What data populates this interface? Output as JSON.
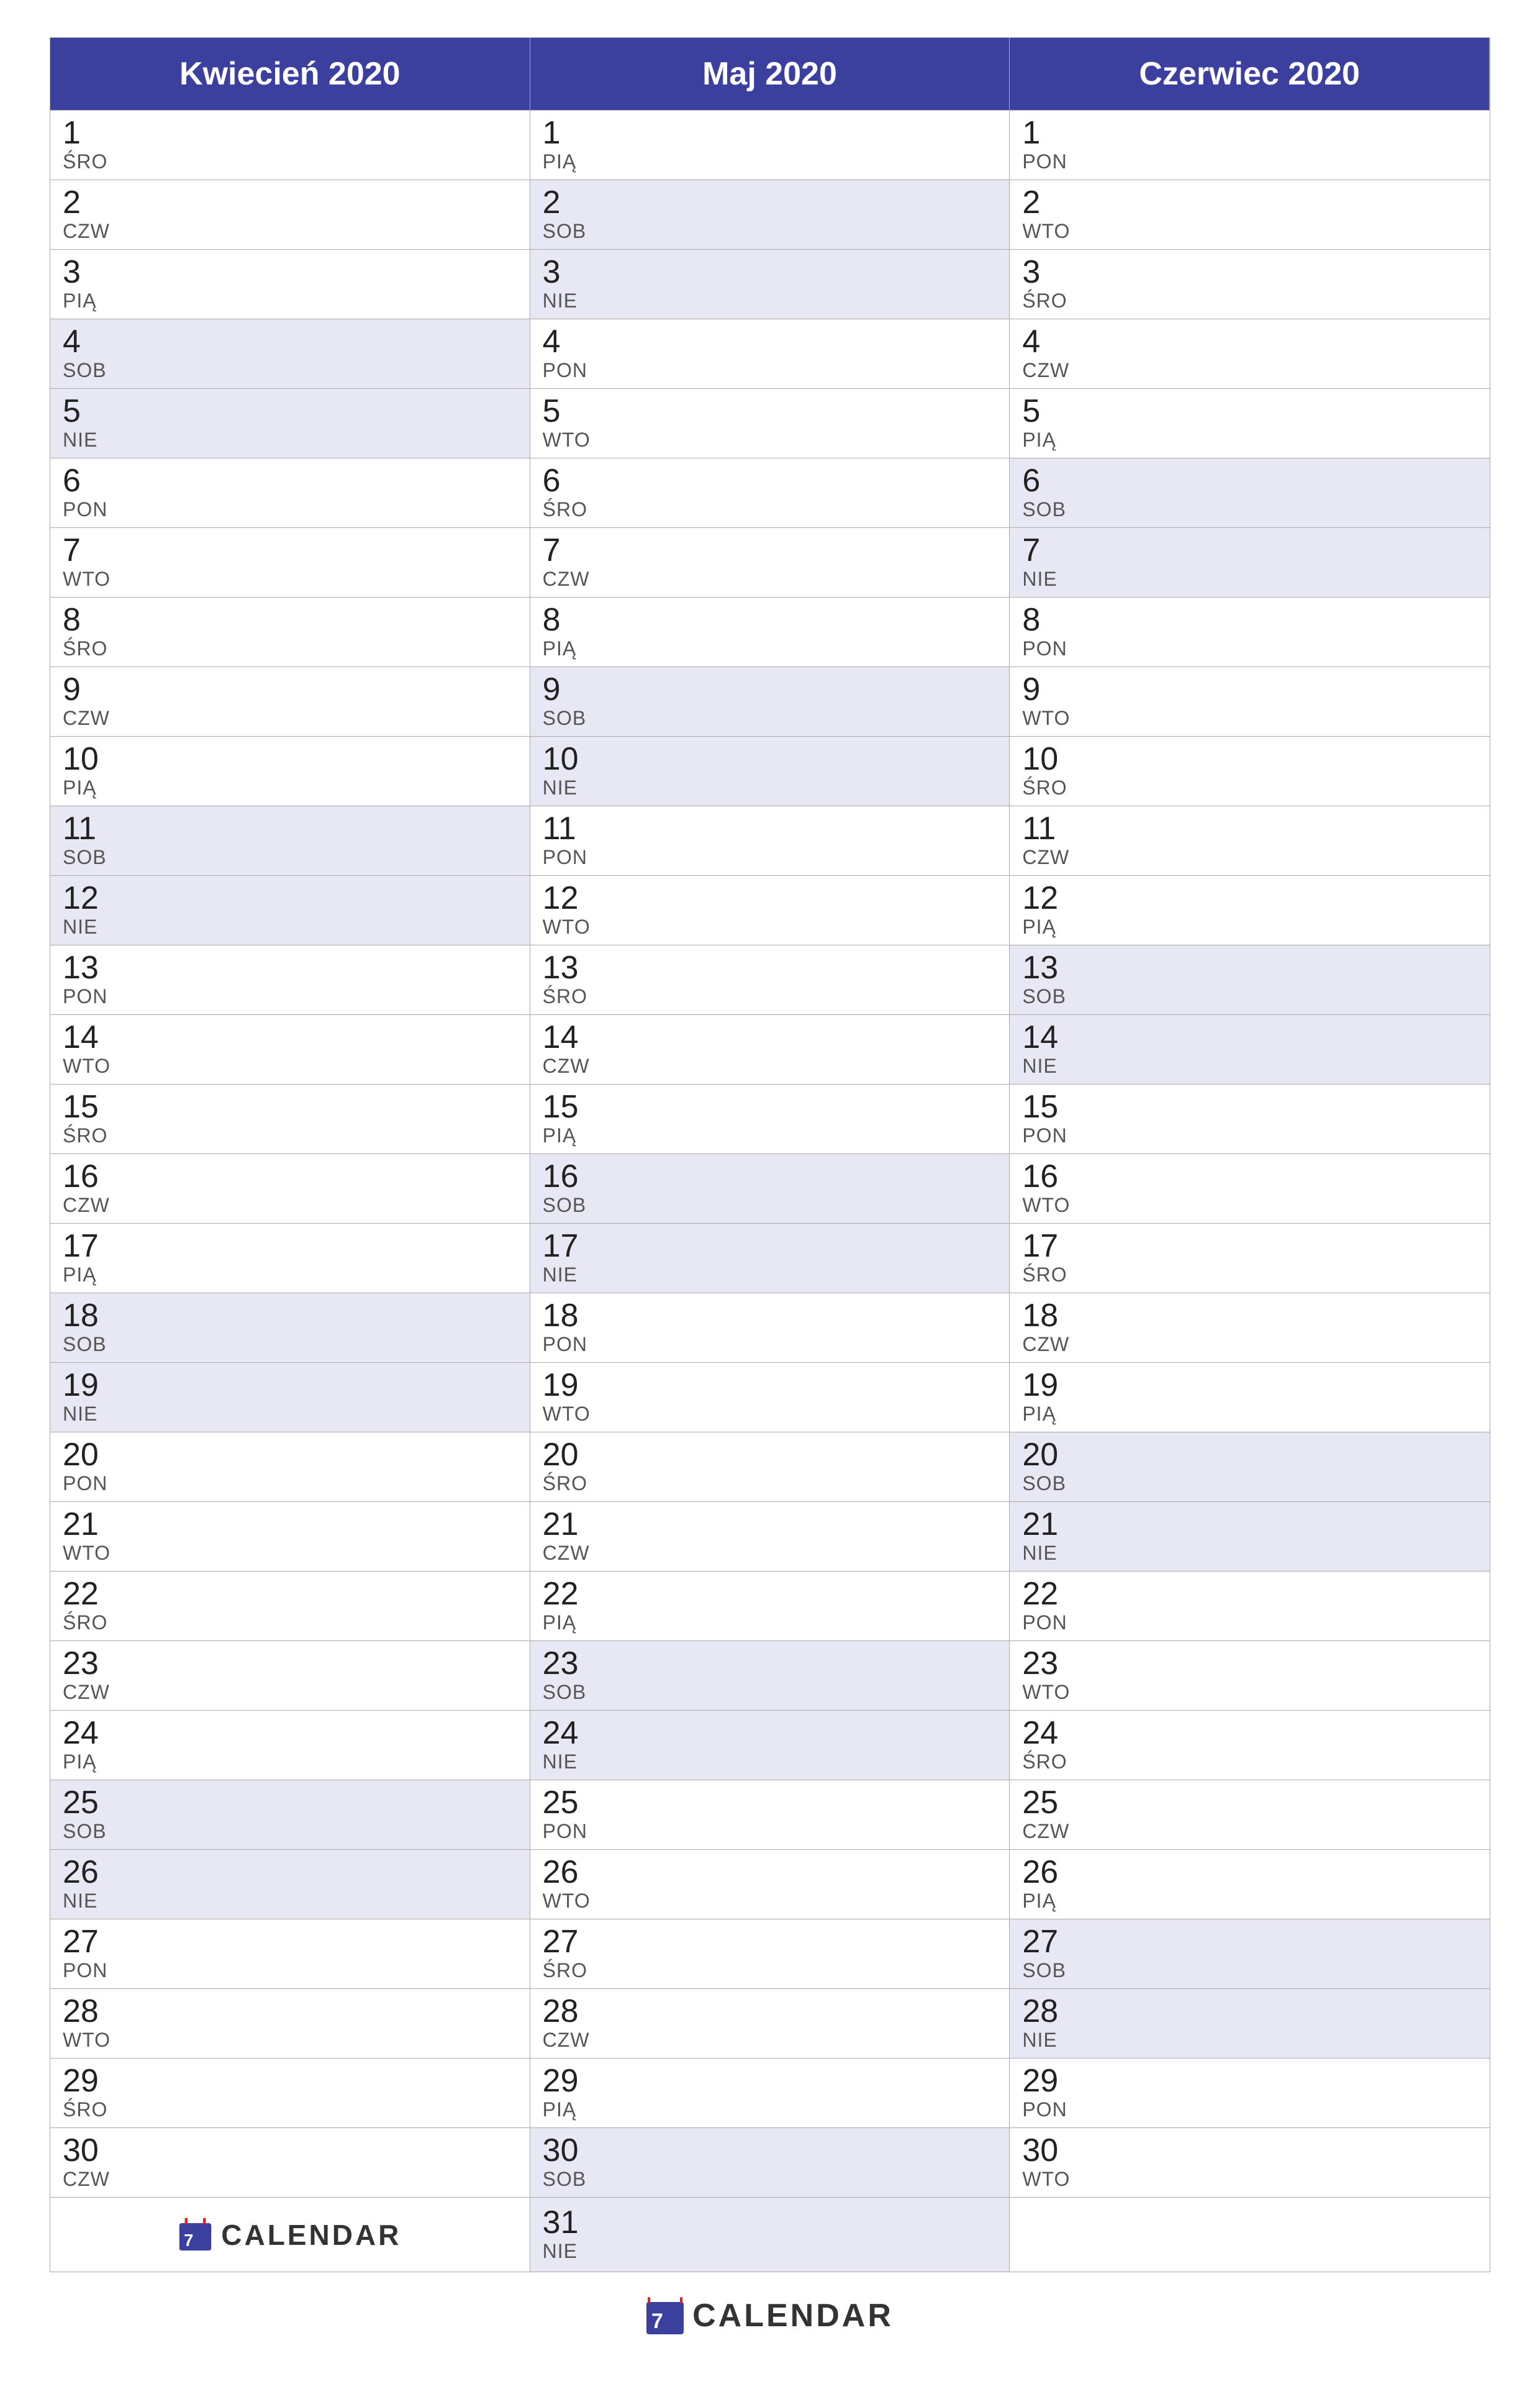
{
  "months": [
    {
      "name": "Kwiecień 2020",
      "days": [
        {
          "num": "1",
          "day": "ŚRO",
          "weekend": false
        },
        {
          "num": "2",
          "day": "CZW",
          "weekend": false
        },
        {
          "num": "3",
          "day": "PIĄ",
          "weekend": false
        },
        {
          "num": "4",
          "day": "SOB",
          "weekend": true
        },
        {
          "num": "5",
          "day": "NIE",
          "weekend": true
        },
        {
          "num": "6",
          "day": "PON",
          "weekend": false
        },
        {
          "num": "7",
          "day": "WTO",
          "weekend": false
        },
        {
          "num": "8",
          "day": "ŚRO",
          "weekend": false
        },
        {
          "num": "9",
          "day": "CZW",
          "weekend": false
        },
        {
          "num": "10",
          "day": "PIĄ",
          "weekend": false
        },
        {
          "num": "11",
          "day": "SOB",
          "weekend": true
        },
        {
          "num": "12",
          "day": "NIE",
          "weekend": true
        },
        {
          "num": "13",
          "day": "PON",
          "weekend": false
        },
        {
          "num": "14",
          "day": "WTO",
          "weekend": false
        },
        {
          "num": "15",
          "day": "ŚRO",
          "weekend": false
        },
        {
          "num": "16",
          "day": "CZW",
          "weekend": false
        },
        {
          "num": "17",
          "day": "PIĄ",
          "weekend": false
        },
        {
          "num": "18",
          "day": "SOB",
          "weekend": true
        },
        {
          "num": "19",
          "day": "NIE",
          "weekend": true
        },
        {
          "num": "20",
          "day": "PON",
          "weekend": false
        },
        {
          "num": "21",
          "day": "WTO",
          "weekend": false
        },
        {
          "num": "22",
          "day": "ŚRO",
          "weekend": false
        },
        {
          "num": "23",
          "day": "CZW",
          "weekend": false
        },
        {
          "num": "24",
          "day": "PIĄ",
          "weekend": false
        },
        {
          "num": "25",
          "day": "SOB",
          "weekend": true
        },
        {
          "num": "26",
          "day": "NIE",
          "weekend": true
        },
        {
          "num": "27",
          "day": "PON",
          "weekend": false
        },
        {
          "num": "28",
          "day": "WTO",
          "weekend": false
        },
        {
          "num": "29",
          "day": "ŚRO",
          "weekend": false
        },
        {
          "num": "30",
          "day": "CZW",
          "weekend": false
        }
      ]
    },
    {
      "name": "Maj 2020",
      "days": [
        {
          "num": "1",
          "day": "PIĄ",
          "weekend": false
        },
        {
          "num": "2",
          "day": "SOB",
          "weekend": true
        },
        {
          "num": "3",
          "day": "NIE",
          "weekend": true
        },
        {
          "num": "4",
          "day": "PON",
          "weekend": false
        },
        {
          "num": "5",
          "day": "WTO",
          "weekend": false
        },
        {
          "num": "6",
          "day": "ŚRO",
          "weekend": false
        },
        {
          "num": "7",
          "day": "CZW",
          "weekend": false
        },
        {
          "num": "8",
          "day": "PIĄ",
          "weekend": false
        },
        {
          "num": "9",
          "day": "SOB",
          "weekend": true
        },
        {
          "num": "10",
          "day": "NIE",
          "weekend": true
        },
        {
          "num": "11",
          "day": "PON",
          "weekend": false
        },
        {
          "num": "12",
          "day": "WTO",
          "weekend": false
        },
        {
          "num": "13",
          "day": "ŚRO",
          "weekend": false
        },
        {
          "num": "14",
          "day": "CZW",
          "weekend": false
        },
        {
          "num": "15",
          "day": "PIĄ",
          "weekend": false
        },
        {
          "num": "16",
          "day": "SOB",
          "weekend": true
        },
        {
          "num": "17",
          "day": "NIE",
          "weekend": true
        },
        {
          "num": "18",
          "day": "PON",
          "weekend": false
        },
        {
          "num": "19",
          "day": "WTO",
          "weekend": false
        },
        {
          "num": "20",
          "day": "ŚRO",
          "weekend": false
        },
        {
          "num": "21",
          "day": "CZW",
          "weekend": false
        },
        {
          "num": "22",
          "day": "PIĄ",
          "weekend": false
        },
        {
          "num": "23",
          "day": "SOB",
          "weekend": true
        },
        {
          "num": "24",
          "day": "NIE",
          "weekend": true
        },
        {
          "num": "25",
          "day": "PON",
          "weekend": false
        },
        {
          "num": "26",
          "day": "WTO",
          "weekend": false
        },
        {
          "num": "27",
          "day": "ŚRO",
          "weekend": false
        },
        {
          "num": "28",
          "day": "CZW",
          "weekend": false
        },
        {
          "num": "29",
          "day": "PIĄ",
          "weekend": false
        },
        {
          "num": "30",
          "day": "SOB",
          "weekend": true
        },
        {
          "num": "31",
          "day": "NIE",
          "weekend": true
        }
      ]
    },
    {
      "name": "Czerwiec 2020",
      "days": [
        {
          "num": "1",
          "day": "PON",
          "weekend": false
        },
        {
          "num": "2",
          "day": "WTO",
          "weekend": false
        },
        {
          "num": "3",
          "day": "ŚRO",
          "weekend": false
        },
        {
          "num": "4",
          "day": "CZW",
          "weekend": false
        },
        {
          "num": "5",
          "day": "PIĄ",
          "weekend": false
        },
        {
          "num": "6",
          "day": "SOB",
          "weekend": true
        },
        {
          "num": "7",
          "day": "NIE",
          "weekend": true
        },
        {
          "num": "8",
          "day": "PON",
          "weekend": false
        },
        {
          "num": "9",
          "day": "WTO",
          "weekend": false
        },
        {
          "num": "10",
          "day": "ŚRO",
          "weekend": false
        },
        {
          "num": "11",
          "day": "CZW",
          "weekend": false
        },
        {
          "num": "12",
          "day": "PIĄ",
          "weekend": false
        },
        {
          "num": "13",
          "day": "SOB",
          "weekend": true
        },
        {
          "num": "14",
          "day": "NIE",
          "weekend": true
        },
        {
          "num": "15",
          "day": "PON",
          "weekend": false
        },
        {
          "num": "16",
          "day": "WTO",
          "weekend": false
        },
        {
          "num": "17",
          "day": "ŚRO",
          "weekend": false
        },
        {
          "num": "18",
          "day": "CZW",
          "weekend": false
        },
        {
          "num": "19",
          "day": "PIĄ",
          "weekend": false
        },
        {
          "num": "20",
          "day": "SOB",
          "weekend": true
        },
        {
          "num": "21",
          "day": "NIE",
          "weekend": true
        },
        {
          "num": "22",
          "day": "PON",
          "weekend": false
        },
        {
          "num": "23",
          "day": "WTO",
          "weekend": false
        },
        {
          "num": "24",
          "day": "ŚRO",
          "weekend": false
        },
        {
          "num": "25",
          "day": "CZW",
          "weekend": false
        },
        {
          "num": "26",
          "day": "PIĄ",
          "weekend": false
        },
        {
          "num": "27",
          "day": "SOB",
          "weekend": true
        },
        {
          "num": "28",
          "day": "NIE",
          "weekend": true
        },
        {
          "num": "29",
          "day": "PON",
          "weekend": false
        },
        {
          "num": "30",
          "day": "WTO",
          "weekend": false
        }
      ]
    }
  ],
  "footer": {
    "brand": "CALENDAR",
    "logo_color_red": "#e52222",
    "logo_color_blue": "#3b3f9e"
  }
}
